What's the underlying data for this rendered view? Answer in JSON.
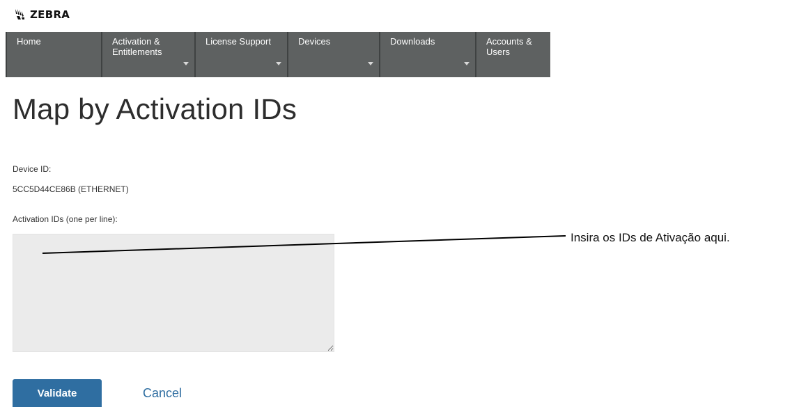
{
  "brand": {
    "name": "ZEBRA",
    "icon": "zebra-head-icon"
  },
  "nav": {
    "items": [
      {
        "label": "Home",
        "has_dropdown": false
      },
      {
        "label": "Activation &\nEntitlements",
        "has_dropdown": true
      },
      {
        "label": "License Support",
        "has_dropdown": true
      },
      {
        "label": "Devices",
        "has_dropdown": true
      },
      {
        "label": "Downloads",
        "has_dropdown": true
      },
      {
        "label": "Accounts &\nUsers",
        "has_dropdown": false
      }
    ]
  },
  "page": {
    "title": "Map by Activation IDs",
    "device_id_label": "Device ID:",
    "device_id_value": "5CC5D44CE86B (ETHERNET)",
    "activation_ids_label": "Activation IDs (one per line):",
    "activation_ids_value": ""
  },
  "callout": {
    "text": "Insira os IDs de Ativação aqui."
  },
  "actions": {
    "validate_label": "Validate",
    "cancel_label": "Cancel"
  },
  "colors": {
    "nav_bg": "#5e6161",
    "primary_button": "#2f6ea1",
    "link": "#2f6ea1",
    "textarea_bg": "#ebebeb"
  }
}
